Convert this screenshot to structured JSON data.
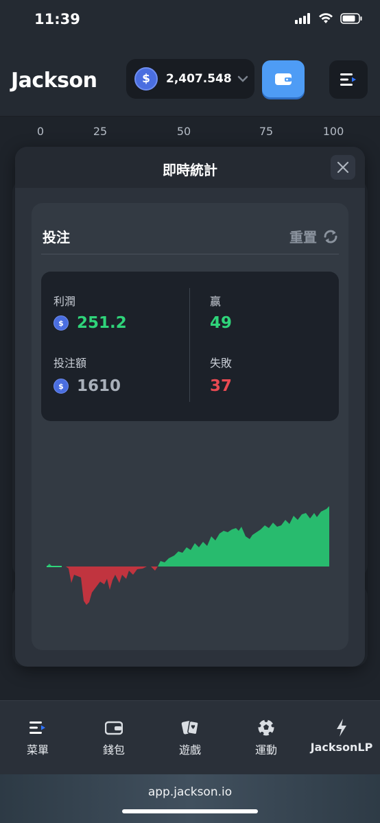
{
  "status_bar": {
    "time": "11:39"
  },
  "header": {
    "logo": "Jackson",
    "balance": "2,407.548"
  },
  "scale": [
    "0",
    "25",
    "50",
    "75",
    "100"
  ],
  "modal": {
    "title": "即時統計",
    "panel": {
      "title": "投注",
      "reset_label": "重置",
      "stats": {
        "profit_label": "利潤",
        "profit_value": "251.2",
        "wagered_label": "投注額",
        "wagered_value": "1610",
        "wins_label": "赢",
        "wins_value": "49",
        "losses_label": "失敗",
        "losses_value": "37"
      }
    }
  },
  "bottom_nav": [
    {
      "label": "菜單",
      "icon": "menu-icon"
    },
    {
      "label": "錢包",
      "icon": "wallet-icon"
    },
    {
      "label": "遊戲",
      "icon": "cards-icon"
    },
    {
      "label": "運動",
      "icon": "soccer-ball-icon"
    },
    {
      "label": "JacksonLP",
      "icon": "lightning-icon"
    }
  ],
  "url_bar": {
    "url": "app.jackson.io"
  },
  "colors": {
    "profit_positive": "#2fd47a",
    "profit_negative": "#c1343f",
    "accent": "#4e9cf5"
  }
}
